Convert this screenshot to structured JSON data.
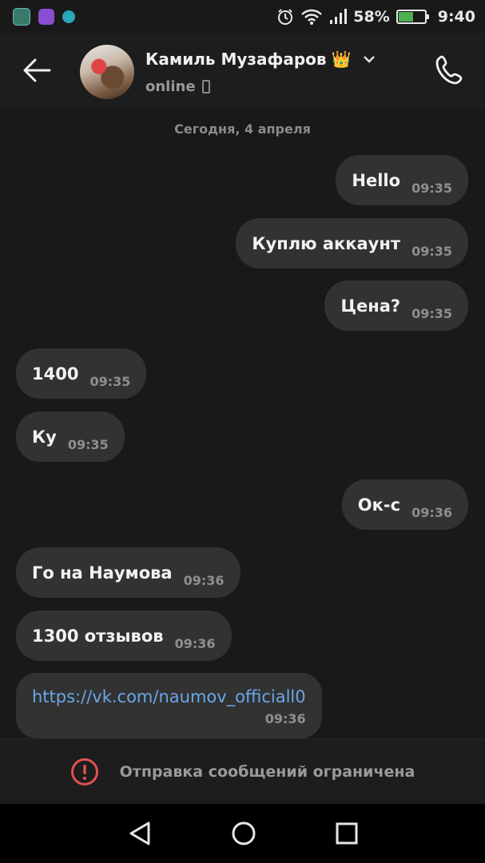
{
  "status_bar": {
    "battery_percent": "58%",
    "battery_level": 0.58,
    "time": "9:40",
    "app_icons": [
      "gallery-app-icon",
      "notes-app-icon",
      "teal-app-icon"
    ]
  },
  "header": {
    "contact_name": "Камиль Музафаров",
    "name_emoji": "👑",
    "presence": "online",
    "icons": [
      "back-arrow-icon",
      "chevron-down-icon",
      "mobile-device-icon",
      "phone-call-icon"
    ]
  },
  "chat": {
    "date_separator": "Сегодня, 4 апреля",
    "messages": [
      {
        "side": "out",
        "text": "Hello",
        "time": "09:35"
      },
      {
        "side": "out",
        "text": "Куплю аккаунт",
        "time": "09:35"
      },
      {
        "side": "out",
        "text": "Цена?",
        "time": "09:35"
      },
      {
        "side": "in",
        "text": "1400",
        "time": "09:35"
      },
      {
        "side": "in",
        "text": "Ку",
        "time": "09:35"
      },
      {
        "side": "out",
        "text": "Ок-с",
        "time": "09:36"
      },
      {
        "side": "in",
        "text": "Го на Наумова",
        "time": "09:36"
      },
      {
        "side": "in",
        "text": "1300 отзывов",
        "time": "09:36"
      },
      {
        "side": "in",
        "text": "https://vk.com/naumov_officiall0",
        "time": "09:36",
        "is_link": true
      }
    ]
  },
  "restriction": {
    "text": "Отправка сообщений ограничена",
    "icon": "warning-circle-icon"
  },
  "colors": {
    "background": "#191919",
    "bubble": "#323232",
    "link": "#6aa6e8",
    "warning": "#e05252"
  }
}
